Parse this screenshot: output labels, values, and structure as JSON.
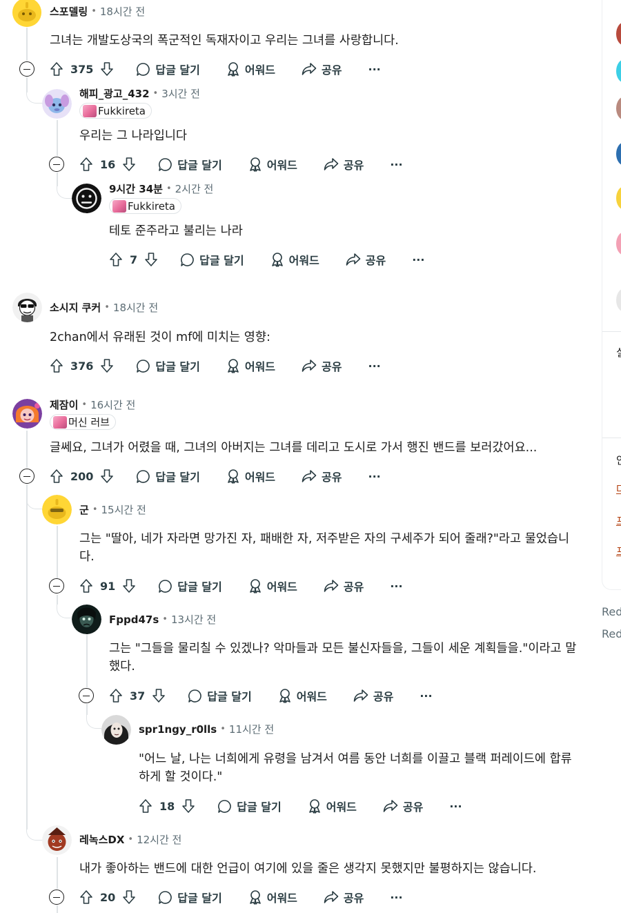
{
  "common": {
    "reply_label": "답글 달기",
    "award_label": "어워드",
    "share_label": "공유",
    "more_label": "···"
  },
  "comments": [
    {
      "username": "스포델링",
      "time": "18시간 전",
      "body": [
        "그녀는 개발도상국의 폭군적인 독재자이고 우리는 그녀를 사랑합니다."
      ],
      "score": "375"
    },
    {
      "username": "해피_광고_432",
      "time": "3시간 전",
      "flair": "Fukkireta",
      "body": [
        "우리는 그 나라입니다"
      ],
      "score": "16"
    },
    {
      "username": "9시간 34분",
      "time": "2시간 전",
      "flair": "Fukkireta",
      "body": [
        "테토 준주라고 불리는 나라"
      ],
      "score": "7"
    },
    {
      "username": "소시지 쿠커",
      "time": "18시간 전",
      "body": [
        "2chan에서 유래된 것이 mf에 미치는 영향:"
      ],
      "score": "376"
    },
    {
      "username": "제잠이",
      "time": "16시간 전",
      "flair": "머신 러브",
      "body": [
        "글쎄요, 그녀가 어렸을 때, 그녀의 아버지는 그녀를 데리고 도시로 가서 행진 밴드를 보러갔어요..."
      ],
      "score": "200"
    },
    {
      "username": "군",
      "time": "15시간 전",
      "body": [
        "그는 \"딸아, 네가 자라면 망가진 자, 패배한 자, 저주받은 자의 구세주가 되어 줄래?\"라고 물었습니",
        "다."
      ],
      "score": "91"
    },
    {
      "username": "Fppd47s",
      "time": "13시간 전",
      "body": [
        "그는 \"그들을 물리칠 수 있겠나? 악마들과 모든 불신자들을, 그들이 세운 계획들을.\"이라고 말",
        "했다."
      ],
      "score": "37"
    },
    {
      "username": "spr1ngy_r0lls",
      "time": "11시간 전",
      "body": [
        "\"어느 날, 나는 너희에게 유령을 남겨서 여름 동안 너희를 이끌고 블랙 퍼레이드에 합류",
        "하게 할 것이다.\""
      ],
      "score": "18"
    },
    {
      "username": "레녹스DX",
      "time": "12시간 전",
      "body": [
        "내가 좋아하는 밴드에 대한 언급이 여기에 있을 줄은 생각지 못했지만 불평하지는 않습니다."
      ],
      "score": "20"
    }
  ],
  "right_rail": {
    "glyphs": [
      "실",
      "안",
      "다",
      "프",
      "프"
    ],
    "footer": [
      "Red",
      "Red"
    ]
  },
  "colors": {
    "upvote_accent": "#d93900",
    "text": "#1c1c1c",
    "meta": "#5c6c74",
    "thread_line": "#dfe3e6"
  },
  "icons": {
    "upvote": "arrow-up-icon",
    "downvote": "arrow-down-icon",
    "reply": "speech-bubble-icon",
    "award": "award-ribbon-icon",
    "share": "share-arrow-icon",
    "more": "ellipsis-icon",
    "collapse": "collapse-minus-icon"
  }
}
